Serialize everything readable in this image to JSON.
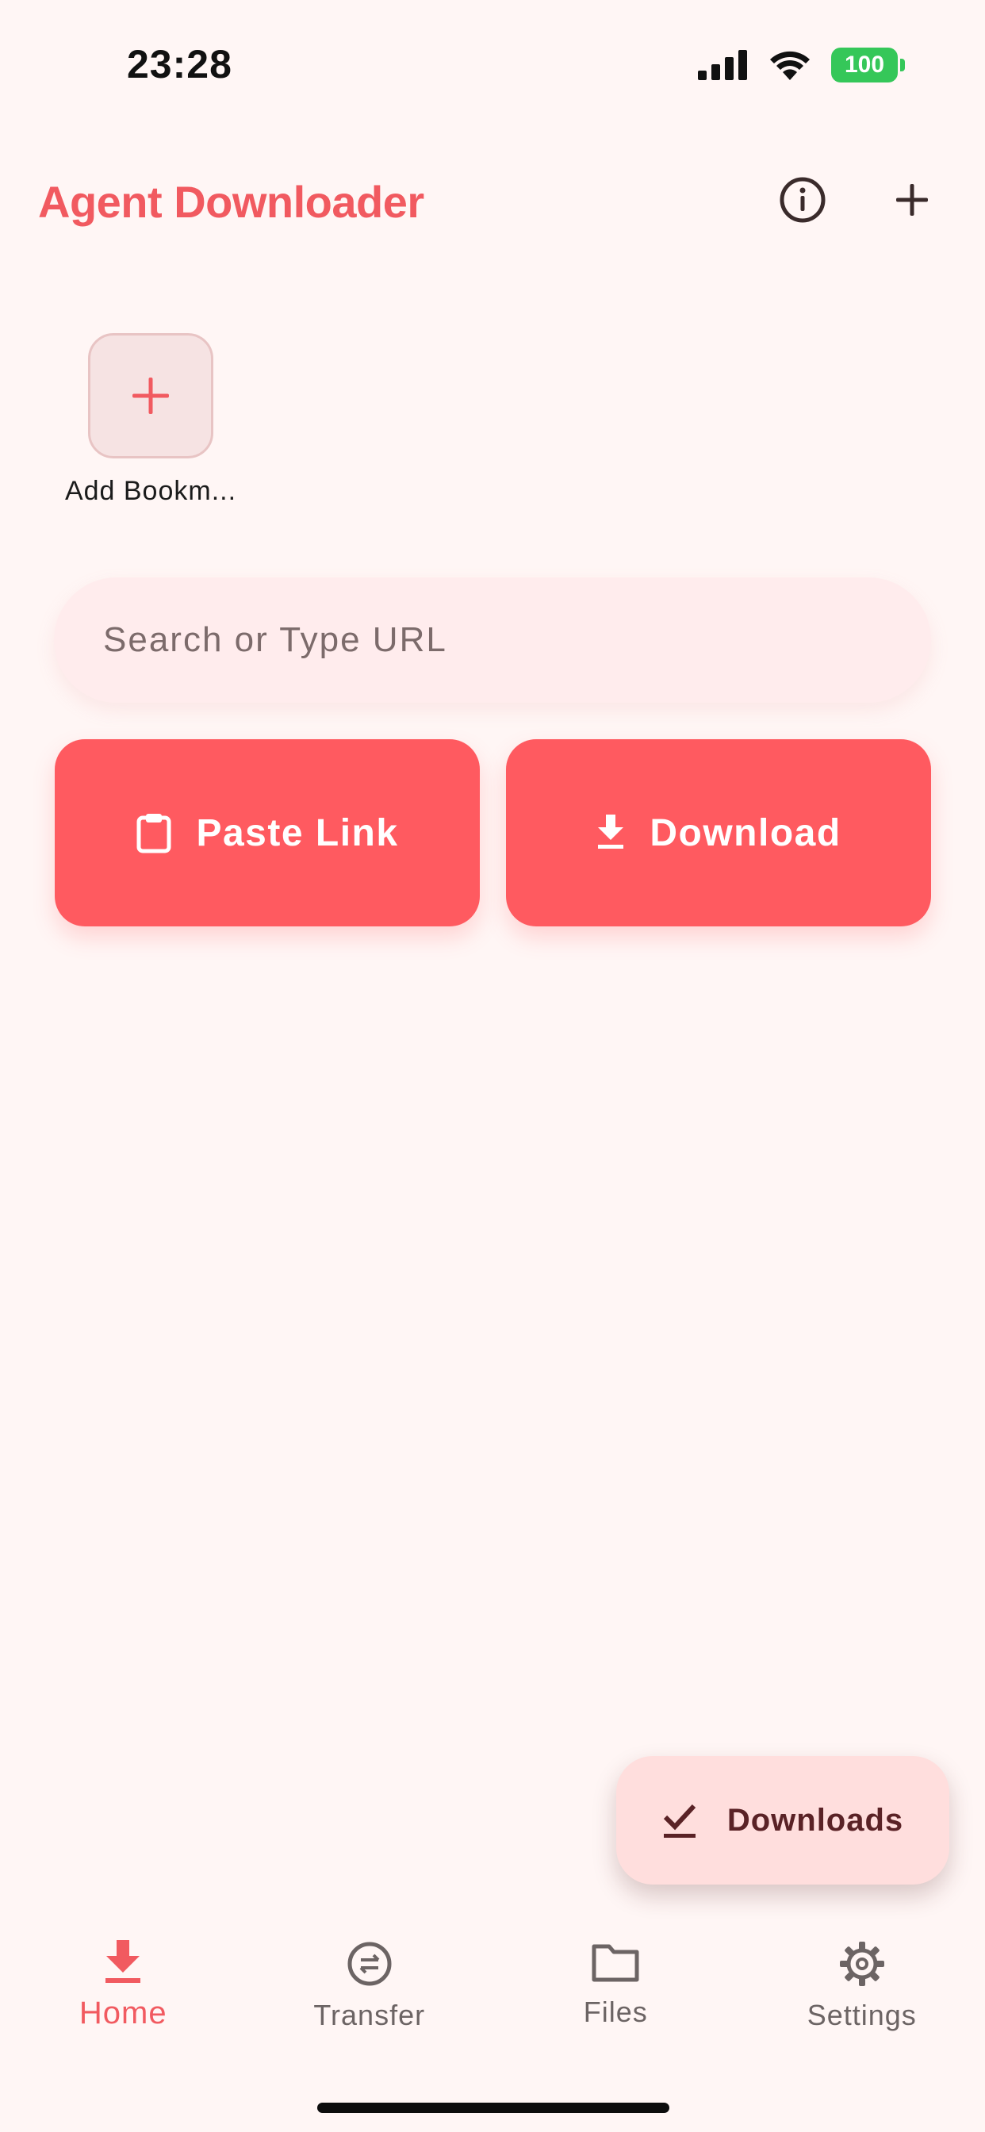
{
  "status_bar": {
    "time": "23:28",
    "battery": "100"
  },
  "header": {
    "title": "Agent Downloader",
    "info_icon": "info-icon",
    "add_icon": "plus-icon"
  },
  "bookmarks": {
    "items": [
      {
        "label": "Add Bookm...",
        "icon": "plus-icon"
      }
    ]
  },
  "search": {
    "placeholder": "Search or Type URL",
    "value": ""
  },
  "actions": {
    "paste_label": "Paste Link",
    "paste_icon": "clipboard-icon",
    "download_label": "Download",
    "download_icon": "download-icon"
  },
  "fab": {
    "label": "Downloads",
    "icon": "download-done-icon"
  },
  "bottom_nav": {
    "items": [
      {
        "label": "Home",
        "icon": "download-icon",
        "active": true
      },
      {
        "label": "Transfer",
        "icon": "transfer-icon",
        "active": false
      },
      {
        "label": "Files",
        "icon": "folder-icon",
        "active": false
      },
      {
        "label": "Settings",
        "icon": "gear-icon",
        "active": false
      }
    ]
  },
  "colors": {
    "accent": "#ff5a60",
    "title": "#f15a60",
    "background": "#fff6f5",
    "fab_background": "#ffdedd",
    "battery": "#35c759"
  }
}
